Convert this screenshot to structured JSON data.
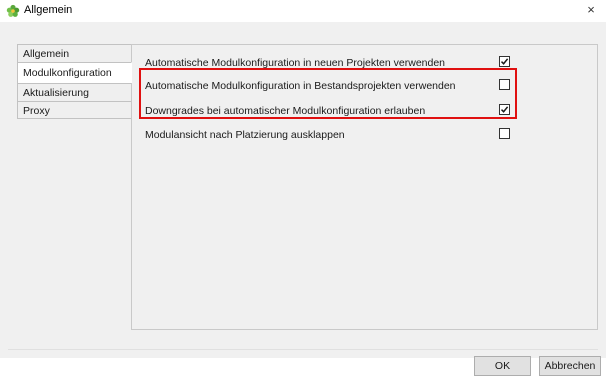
{
  "window": {
    "title": "Allgemein",
    "close_symbol": "×"
  },
  "tabs": [
    {
      "label": "Allgemein"
    },
    {
      "label": "Modulkonfiguration"
    },
    {
      "label": "Aktualisierung"
    },
    {
      "label": "Proxy"
    }
  ],
  "active_tab": "Modulkonfiguration",
  "options": [
    {
      "label": "Automatische Modulkonfiguration in neuen Projekten verwenden",
      "checked": true
    },
    {
      "label": "Automatische Modulkonfiguration in Bestandsprojekten verwenden",
      "checked": false
    },
    {
      "label": "Downgrades bei automatischer Modulkonfiguration erlauben",
      "checked": true
    },
    {
      "label": "Modulansicht nach Platzierung ausklappen",
      "checked": false
    }
  ],
  "buttons": {
    "ok": "OK",
    "cancel": "Abbrechen"
  },
  "colors": {
    "highlight": "#e01010",
    "background": "#f0f0f0"
  },
  "icons": {
    "app": "green-flower-icon",
    "close": "close-icon"
  }
}
